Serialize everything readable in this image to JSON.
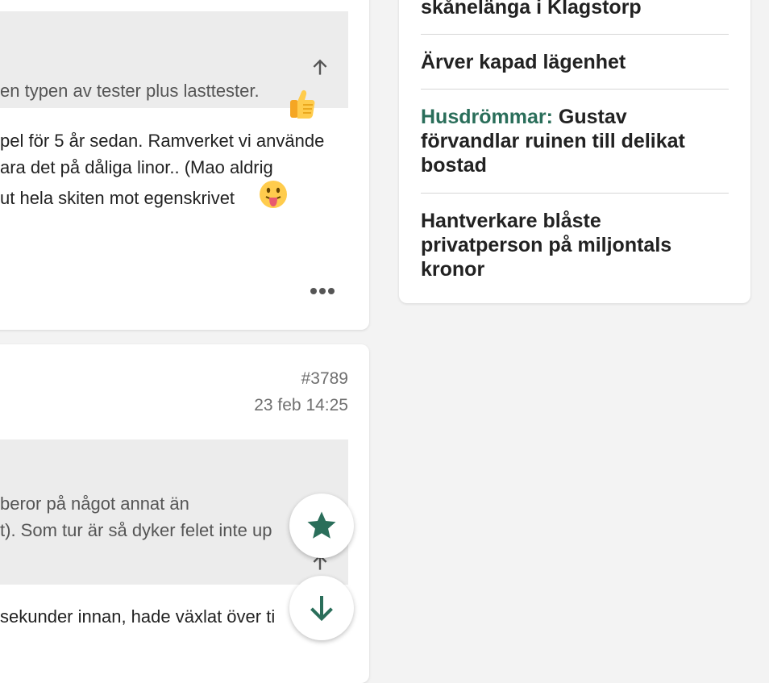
{
  "post1": {
    "quote_line": "en typen av tester plus lasttester.",
    "body_lines": [
      "pel för 5 år sedan. Ramverket vi använde",
      "ara det på dåliga linor.. (Mao aldrig",
      "ut hela skiten mot egenskrivet"
    ]
  },
  "post2": {
    "number": "#3789",
    "timestamp": "23 feb 14:25",
    "quote_lines": [
      "beror på något annat än",
      "t). Som tur är så dyker felet inte up"
    ],
    "body_line": "sekunder innan, hade växlat över ti"
  },
  "sidebar": {
    "partial_top": "skånelänga i Klagstorp",
    "items": [
      {
        "tag": "",
        "title": "Ärver kapad lägenhet"
      },
      {
        "tag": "Husdrömmar:",
        "title": " Gustav förvandlar ruinen till delikat bostad"
      },
      {
        "tag": "",
        "title": "Hantverkare blåste privatperson på miljontals kronor"
      }
    ]
  },
  "colors": {
    "accent": "#2a6e5a"
  },
  "icons": [
    "arrow-up-icon",
    "thumbs-up-emoji",
    "tongue-emoji",
    "more-dots-icon",
    "star-icon",
    "arrow-down-icon"
  ]
}
